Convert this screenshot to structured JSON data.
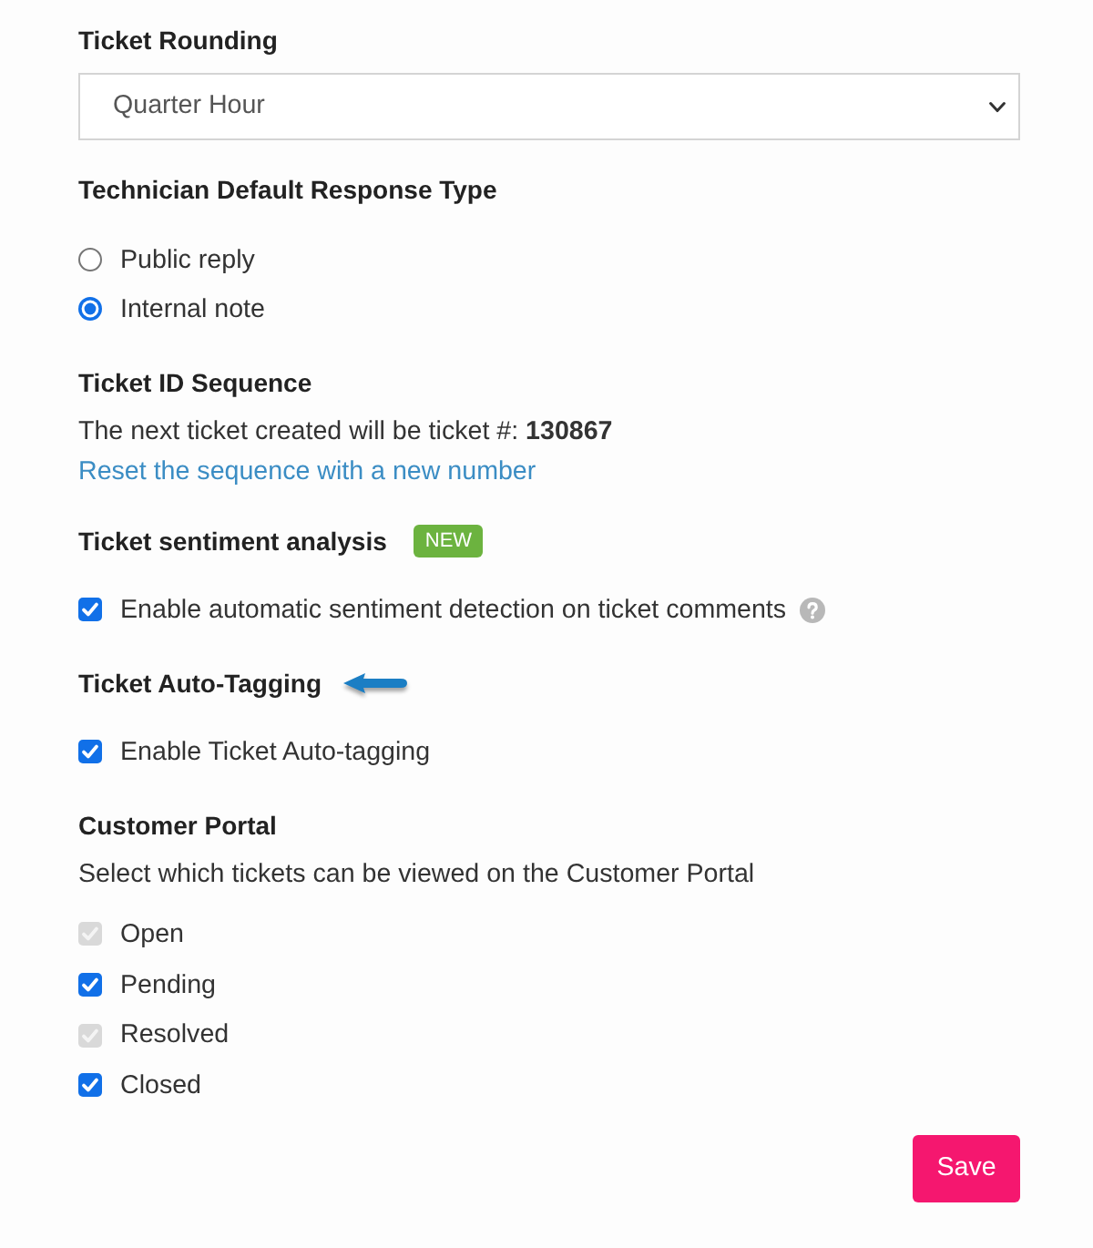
{
  "sections": [
    {
      "kind": "select",
      "title": "Ticket Rounding",
      "value": "Quarter Hour"
    },
    {
      "kind": "radio",
      "title": "Technician Default Response Type",
      "options": [
        {
          "label": "Public reply",
          "selected": false
        },
        {
          "label": "Internal note",
          "selected": true
        }
      ]
    },
    {
      "kind": "sequence",
      "title": "Ticket ID Sequence",
      "text": "The next ticket created will be ticket #: **130867**",
      "link": "Reset the sequence with a new number"
    },
    {
      "kind": "checkbox",
      "title": "Ticket sentiment analysis",
      "badge": "NEW",
      "options": [
        {
          "label": "Enable automatic sentiment detection on ticket comments",
          "checked": true,
          "disabled": false,
          "help": true
        }
      ]
    },
    {
      "kind": "checkbox",
      "title": "Ticket Auto-Tagging",
      "pointer_arrow": true,
      "options": [
        {
          "label": "Enable Ticket Auto-tagging",
          "checked": true,
          "disabled": false
        }
      ]
    },
    {
      "kind": "checkbox",
      "title": "Customer Portal",
      "description": "Select which tickets can be viewed on the Customer Portal",
      "options": [
        {
          "label": "Open",
          "checked": true,
          "disabled": true
        },
        {
          "label": "Pending",
          "checked": true,
          "disabled": false
        },
        {
          "label": "Resolved",
          "checked": true,
          "disabled": true
        },
        {
          "label": "Closed",
          "checked": true,
          "disabled": false
        }
      ]
    }
  ],
  "save_button": "Save"
}
